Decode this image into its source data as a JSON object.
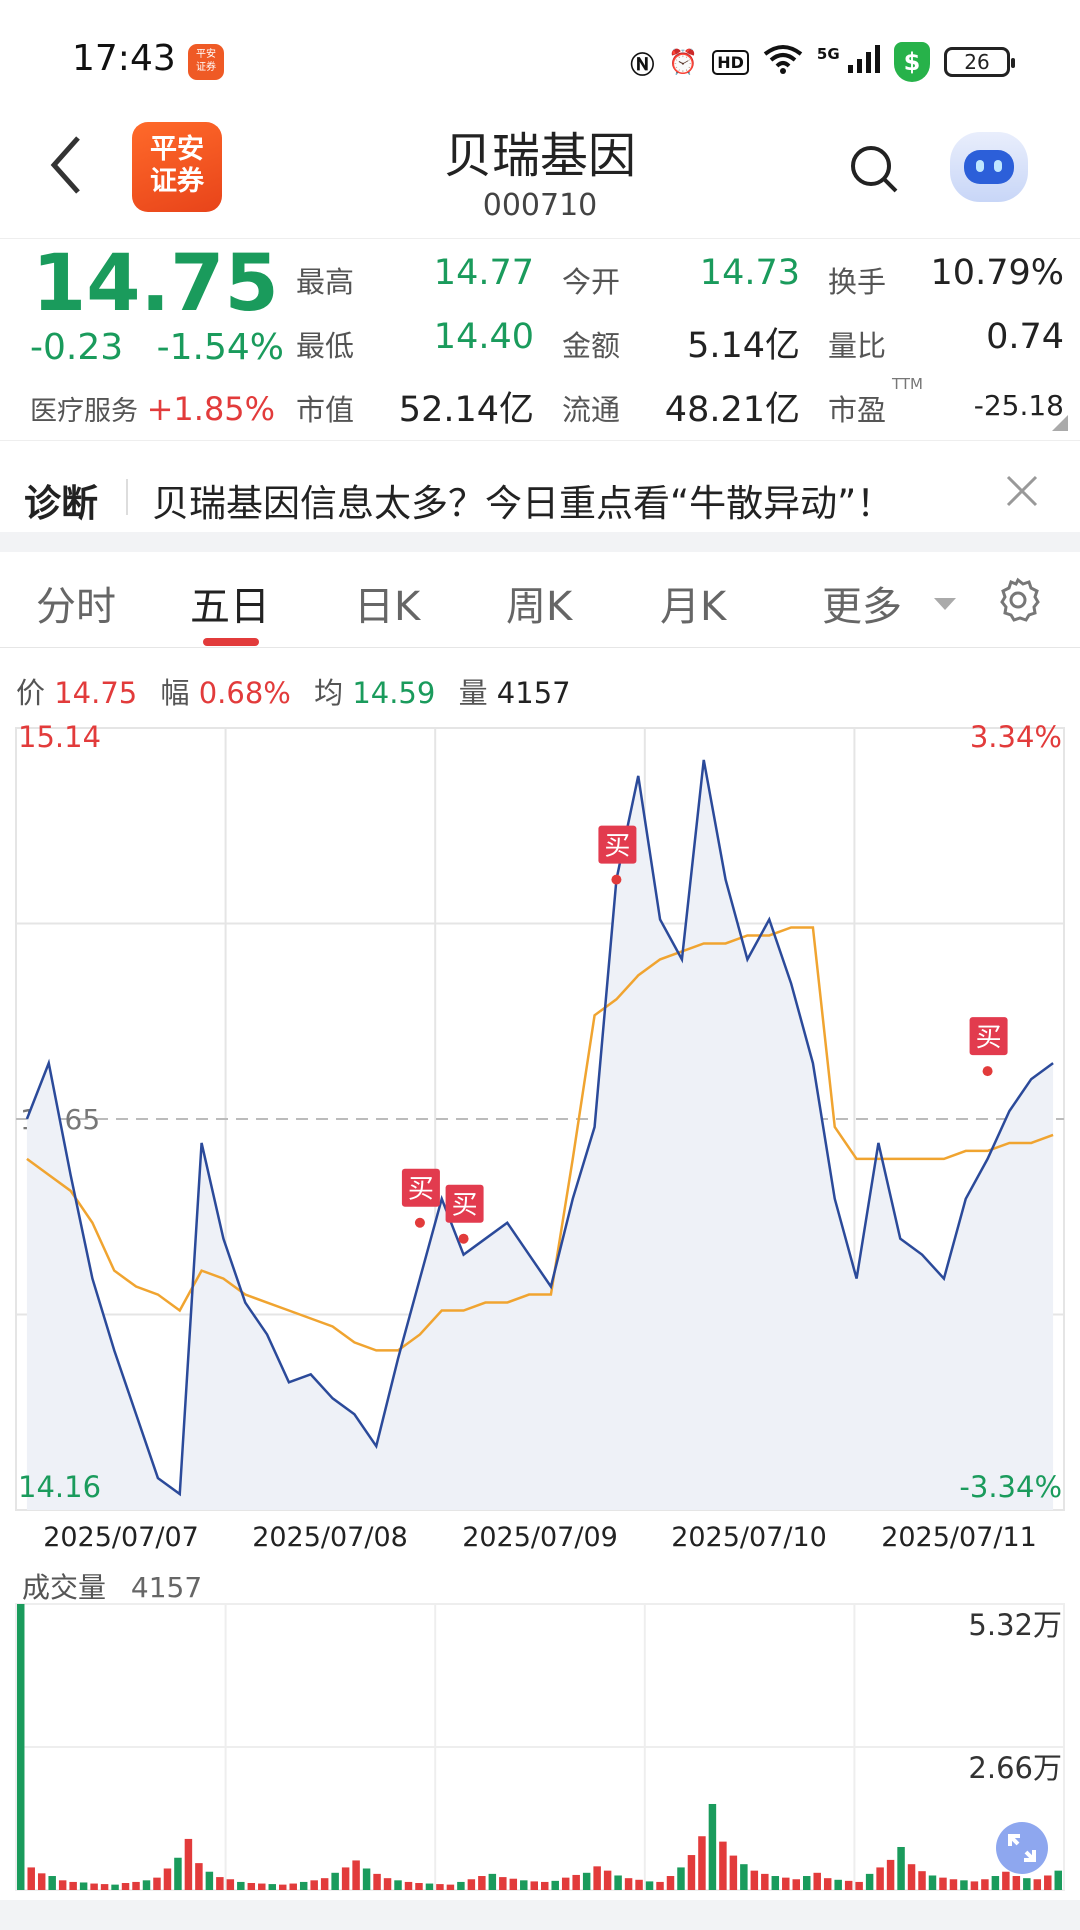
{
  "status": {
    "time": "17:43",
    "app_badge": "平安\n证券",
    "icons": [
      "nfc-icon",
      "alarm-icon",
      "hd-icon",
      "wifi-icon",
      "5g-signal-icon",
      "shield-icon",
      "battery-icon"
    ],
    "network": "5G",
    "battery": "26"
  },
  "nav": {
    "logo_line1": "平安",
    "logo_line2": "证券",
    "title": "贝瑞基因",
    "code": "000710"
  },
  "quote": {
    "price": "14.75",
    "change": "-0.23",
    "change_pct": "-1.54%",
    "sector_name": "医疗服务",
    "sector_pct": "+1.85%",
    "fields": [
      {
        "label": "最高",
        "value": "14.77"
      },
      {
        "label": "今开",
        "value": "14.73"
      },
      {
        "label": "换手",
        "value": "10.79%"
      },
      {
        "label": "最低",
        "value": "14.40"
      },
      {
        "label": "金额",
        "value": "5.14亿"
      },
      {
        "label": "量比",
        "value": "0.74"
      },
      {
        "label": "市值",
        "value": "52.14亿"
      },
      {
        "label": "流通",
        "value": "48.21亿"
      },
      {
        "label": "市盈",
        "value": "-25.18"
      }
    ],
    "ttm": "TTM",
    "colors": {
      "down": "#1a9b5c",
      "up": "#e23b3b"
    }
  },
  "diagnosis": {
    "tag": "诊断",
    "text": "贝瑞基因信息太多？今日重点看“牛散异动”！"
  },
  "tabs": {
    "items": [
      "分时",
      "五日",
      "日K",
      "周K",
      "月K",
      "更多"
    ],
    "active": "五日"
  },
  "info": {
    "price_label": "价",
    "price": "14.75",
    "range_label": "幅",
    "range": "0.68%",
    "avg_label": "均",
    "avg": "14.59",
    "vol_label": "量",
    "vol": "4157"
  },
  "chart_data": {
    "type": "line",
    "x": [
      "2025/07/07",
      "2025/07/08",
      "2025/07/09",
      "2025/07/10",
      "2025/07/11"
    ],
    "ylim": [
      14.16,
      15.14
    ],
    "ref_price": 14.65,
    "y_top_label": "15.14",
    "y_bottom_label": "14.16",
    "pct_top_label": "3.34%",
    "pct_bottom_label": "-3.34%",
    "series": [
      {
        "values": [
          14.65,
          14.72,
          14.58,
          14.45,
          14.36,
          14.28,
          14.2,
          14.18,
          14.62,
          14.5,
          14.42,
          14.38,
          14.32,
          14.33,
          14.3,
          14.28,
          14.24,
          14.35,
          14.45,
          14.55,
          14.48,
          14.5,
          14.52,
          14.48,
          14.44,
          14.55,
          14.64,
          14.95,
          15.08,
          14.9,
          14.85,
          15.1,
          14.95,
          14.85,
          14.9,
          14.82,
          14.72,
          14.55,
          14.45,
          14.62,
          14.5,
          14.48,
          14.45,
          14.55,
          14.6,
          14.66,
          14.7,
          14.72
        ]
      },
      {
        "values": [
          14.6,
          14.58,
          14.56,
          14.52,
          14.46,
          14.44,
          14.43,
          14.41,
          14.46,
          14.45,
          14.43,
          14.42,
          14.41,
          14.4,
          14.39,
          14.37,
          14.36,
          14.36,
          14.38,
          14.41,
          14.41,
          14.42,
          14.42,
          14.43,
          14.43,
          14.6,
          14.78,
          14.8,
          14.83,
          14.85,
          14.86,
          14.87,
          14.87,
          14.88,
          14.88,
          14.89,
          14.89,
          14.64,
          14.6,
          14.6,
          14.6,
          14.6,
          14.6,
          14.61,
          14.61,
          14.62,
          14.62,
          14.63
        ]
      }
    ],
    "buy_markers": [
      {
        "x_index": 18,
        "y": 14.52,
        "label": "买"
      },
      {
        "x_index": 20,
        "y": 14.5,
        "label": "买"
      },
      {
        "x_index": 27,
        "y": 14.95,
        "label": "买"
      },
      {
        "x_index": 44,
        "y": 14.71,
        "label": "买"
      }
    ],
    "volume": {
      "head_label": "成交量",
      "current": "4157",
      "max_label": "5.32万",
      "mid_label": "2.66万",
      "bars": [
        53200,
        4200,
        3100,
        2600,
        1800,
        1500,
        1400,
        1200,
        1100,
        1000,
        1300,
        1500,
        1800,
        2300,
        4000,
        6000,
        9500,
        5000,
        3400,
        2400,
        2000,
        1500,
        1300,
        1200,
        1100,
        1000,
        1200,
        1500,
        1800,
        2200,
        3200,
        4200,
        5500,
        4000,
        3000,
        2200,
        1800,
        1500,
        1300,
        1200,
        1100,
        1000,
        1500,
        2000,
        2600,
        3000,
        2400,
        2100,
        1800,
        1600,
        1500,
        1700,
        2300,
        2800,
        3200,
        4400,
        3600,
        2700,
        2200,
        1900,
        1600,
        1500,
        2600,
        4200,
        6500,
        10000,
        16000,
        9000,
        6400,
        4800,
        3600,
        3000,
        2600,
        2300,
        2000,
        2600,
        3200,
        2200,
        1900,
        1700,
        1500,
        3000,
        4200,
        5600,
        8000,
        4800,
        3500,
        2700,
        2300,
        2000,
        1800,
        1600,
        2000,
        2600,
        3400,
        2600,
        2200,
        2000,
        2700,
        3600
      ]
    }
  },
  "volume_colors": {
    "up": "#e23b3b",
    "down": "#1a9b5c"
  }
}
